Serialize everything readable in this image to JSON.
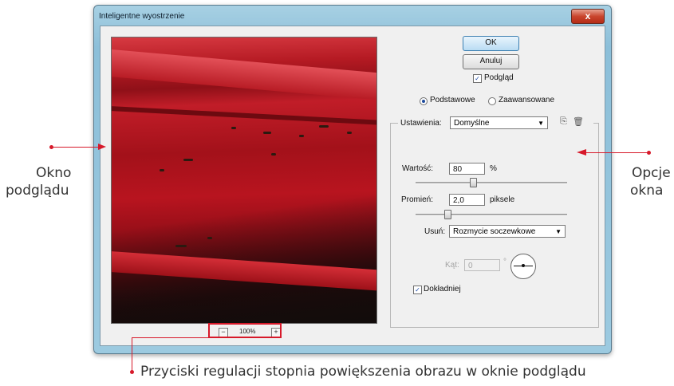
{
  "window": {
    "title": "Inteligentne wyostrzenie",
    "close_glyph": "x"
  },
  "zoom": {
    "level": "100%",
    "minus": "−",
    "plus": "+"
  },
  "buttons": {
    "ok": "OK",
    "cancel": "Anuluj"
  },
  "preview_check": {
    "label": "Podgląd",
    "checked": true
  },
  "mode": {
    "basic": "Podstawowe",
    "advanced": "Zaawansowane",
    "selected": "basic"
  },
  "settings": {
    "label": "Ustawienia:",
    "value": "Domyślne"
  },
  "amount": {
    "label": "Wartość:",
    "value": "80",
    "unit": "%",
    "slider_fraction": 0.38
  },
  "radius": {
    "label": "Promień:",
    "value": "2,0",
    "unit": "piksele",
    "slider_fraction": 0.21
  },
  "remove": {
    "label": "Usuń:",
    "value": "Rozmycie soczewkowe"
  },
  "angle": {
    "label": "Kąt:",
    "value": "0",
    "unit": "°"
  },
  "accurate": {
    "label": "Dokładniej",
    "checked": true
  },
  "annotations": {
    "left_line1": "Okno",
    "left_line2": "podglądu",
    "right_line1": "Opcje",
    "right_line2": "okna",
    "bottom": "Przyciski regulacji stopnia powiększenia obrazu w oknie podglądu",
    "accent_color": "#d7192a"
  }
}
